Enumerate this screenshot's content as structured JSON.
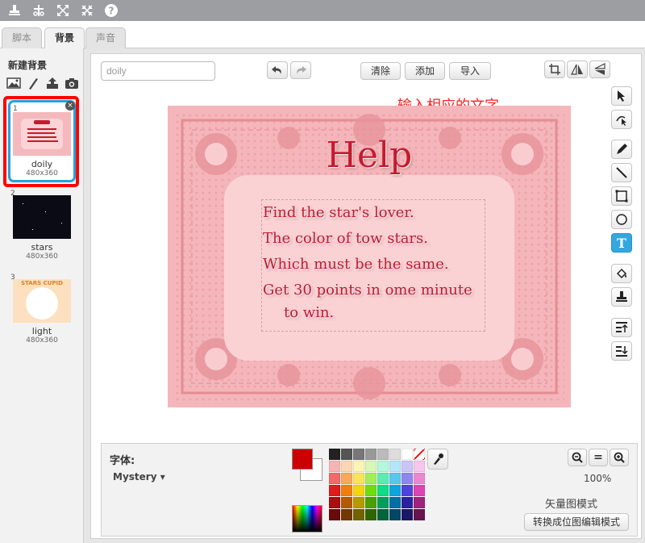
{
  "tabs": [
    {
      "label": "脚本"
    },
    {
      "label": "背景"
    },
    {
      "label": "声音"
    }
  ],
  "left_panel": {
    "new_backdrop_title": "新建背景",
    "backdrops": [
      {
        "index": "1",
        "name": "doily",
        "size": "480x360"
      },
      {
        "index": "2",
        "name": "stars",
        "size": "480x360"
      },
      {
        "index": "3",
        "name": "light",
        "size": "480x360",
        "thumb_text": "STARS CUPID"
      }
    ]
  },
  "editor": {
    "name_value": "doily",
    "toolbar": {
      "clear_label": "清除",
      "add_label": "添加",
      "import_label": "导入"
    },
    "annotation": "输入相应的文字",
    "canvas": {
      "title": "Help",
      "lines": [
        "Find the star's lover.",
        "The color of tow stars.",
        "Which must be the same.",
        "Get 30 points in ome minute",
        "to win."
      ]
    }
  },
  "bottom": {
    "font_label": "字体:",
    "font_value": "Mystery ▾",
    "zoom_percent": "100%",
    "mode_label": "矢量图模式",
    "convert_label": "转换成位图编辑模式",
    "primary_color": "#cc0000",
    "secondary_color": "#ffffff"
  }
}
